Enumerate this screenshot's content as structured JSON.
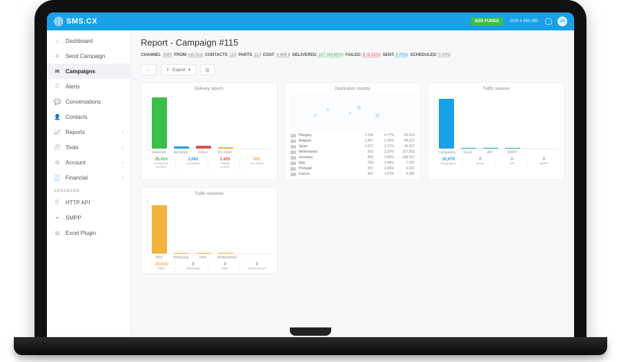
{
  "brand": {
    "name": "SMS.CX"
  },
  "header": {
    "add_funds": "ADD FUNDS",
    "balance": "EUR 4 950,490",
    "avatar_initials": "JA"
  },
  "sidebar": {
    "items": [
      {
        "label": "Dashboard",
        "icon": "home"
      },
      {
        "label": "Send Campaign",
        "icon": "send"
      },
      {
        "label": "Campaigns",
        "icon": "mail",
        "active": true
      },
      {
        "label": "Alerts",
        "icon": "clock"
      },
      {
        "label": "Conversations",
        "icon": "chat"
      },
      {
        "label": "Contacts",
        "icon": "user"
      },
      {
        "label": "Reports",
        "icon": "chart",
        "chevron": true
      },
      {
        "label": "Tools",
        "icon": "tools",
        "chevron": true
      },
      {
        "label": "Account",
        "icon": "gear",
        "chevron": true
      },
      {
        "label": "Financial",
        "icon": "doc",
        "chevron": true
      }
    ],
    "group_advanced": "ADVANCED",
    "advanced": [
      {
        "label": "HTTP API",
        "icon": "api"
      },
      {
        "label": "SMPP",
        "icon": "plug"
      },
      {
        "label": "Excel Plugin",
        "icon": "xls"
      }
    ]
  },
  "page": {
    "title": "Report - Campaign #115"
  },
  "summary": {
    "channel_k": "CHANNEL",
    "channel_v": "SMS",
    "from_k": "FROM",
    "from_v": "InfoText",
    "contacts_k": "CONTACTS",
    "contacts_v": "113",
    "parts_k": "PARTS",
    "parts_v": "113",
    "cost_k": "COST",
    "cost_v": "4.469 €",
    "delivered_k": "DELIVERED:",
    "delivered_v": "107 (94.69%)",
    "failed_k": "FAILED:",
    "failed_v": "6 (5.31%)",
    "sent_k": "SENT:",
    "sent_v": "0 (0%)",
    "scheduled_k": "SCHEDULED:",
    "scheduled_v": "0 (0%)"
  },
  "toolbar": {
    "back": "←",
    "export": "Export",
    "columns": "☰"
  },
  "chart_data": [
    {
      "type": "bar",
      "title": "Delivery reports",
      "categories": [
        "Delivered",
        "Accepted",
        "Failed",
        "No report"
      ],
      "values": [
        94.69,
        4,
        5.31,
        3
      ],
      "colors": [
        "#3abf4a",
        "#1aa0e6",
        "#e24c4c",
        "#f4b33f"
      ],
      "ylim": [
        0,
        100
      ],
      "stats": [
        {
          "label": "Delivered",
          "value": "25,414",
          "pct": "94.69%",
          "color": "#3abf4a"
        },
        {
          "label": "Accepted",
          "value": "1,062",
          "pct": "",
          "color": "#1aa0e6"
        },
        {
          "label": "Failed",
          "value": "1,425",
          "pct": "5.31%",
          "color": "#e24c4c"
        },
        {
          "label": "No report",
          "value": "805",
          "pct": "",
          "color": "#f4b33f"
        }
      ]
    },
    {
      "type": "table",
      "title": "Destination country",
      "rows": [
        {
          "country": "Hungary",
          "a": "1,545",
          "b": "5.77%",
          "c": "50,614"
        },
        {
          "country": "Belgium",
          "a": "1,407",
          "b": "5.26%",
          "c": "48,031"
        },
        {
          "country": "Spain",
          "a": "1,027",
          "b": "3.71%",
          "c": "46,437"
        },
        {
          "country": "Netherlands",
          "a": "916",
          "b": "3.20%",
          "c": "127,853"
        },
        {
          "country": "Germany",
          "a": "856",
          "b": "2.85%",
          "c": "146,967"
        },
        {
          "country": "Italy",
          "a": "759",
          "b": "2.84%",
          "c": "7,282"
        },
        {
          "country": "Portugal",
          "a": "557",
          "b": "2.04%",
          "c": "6,415"
        },
        {
          "country": "France",
          "a": "447",
          "b": "1.67%",
          "c": "5,386"
        }
      ]
    },
    {
      "type": "bar",
      "title": "Traffic sources",
      "categories": [
        "Campaigns",
        "Excel",
        "API",
        "SMPP"
      ],
      "values": [
        92,
        1,
        1,
        1
      ],
      "colors": [
        "#1aa0e6",
        "#1aa0e6",
        "#1aa0e6",
        "#1aa0e6"
      ],
      "ylim": [
        0,
        100
      ],
      "stats": [
        {
          "label": "Campaigns",
          "value": "32,679",
          "pct": "",
          "color": "#1aa0e6"
        },
        {
          "label": "Excel",
          "value": "0",
          "pct": "",
          "color": "#999"
        },
        {
          "label": "API",
          "value": "0",
          "pct": "",
          "color": "#999"
        },
        {
          "label": "SMPP",
          "value": "0",
          "pct": "",
          "color": "#999"
        }
      ]
    },
    {
      "type": "bar",
      "title": "Traffic channels",
      "categories": [
        "SMS",
        "Whatsapp",
        "Viber",
        "Multichannel"
      ],
      "values": [
        90,
        1,
        1,
        1
      ],
      "colors": [
        "#f4b33f",
        "#f4b33f",
        "#f4b33f",
        "#f4b33f"
      ],
      "ylim": [
        0,
        100
      ],
      "stats": [
        {
          "label": "SMS",
          "value": "28,618",
          "pct": "",
          "color": "#f4b33f"
        },
        {
          "label": "Whatsapp",
          "value": "0",
          "pct": "",
          "color": "#999"
        },
        {
          "label": "Viber",
          "value": "0",
          "pct": "",
          "color": "#999"
        },
        {
          "label": "Multichannel",
          "value": "0",
          "pct": "",
          "color": "#999"
        }
      ]
    }
  ]
}
